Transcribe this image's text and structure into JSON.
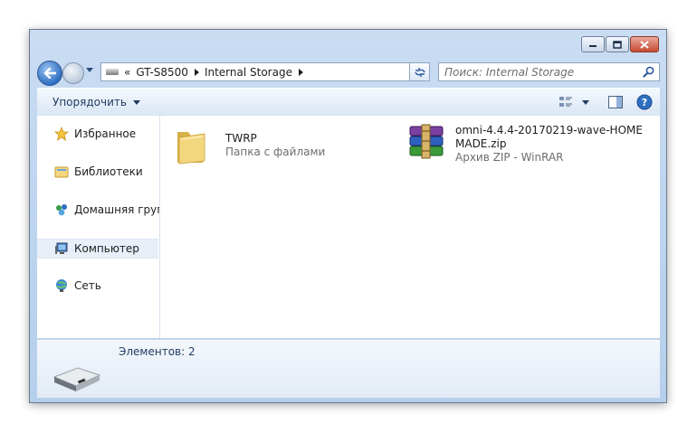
{
  "window": {
    "controls": {
      "minimize_icon": "minimize-icon",
      "maximize_icon": "maximize-icon",
      "close_icon": "close-icon"
    }
  },
  "address": {
    "overflow": "«",
    "segments": [
      "GT-S8500",
      "Internal Storage"
    ]
  },
  "search": {
    "placeholder": "Поиск: Internal Storage"
  },
  "toolbar": {
    "organize_label": "Упорядочить",
    "view_icon": "view-options-icon",
    "preview_icon": "preview-pane-icon",
    "help_icon": "help-icon"
  },
  "sidebar": {
    "items": [
      {
        "label": "Избранное",
        "icon": "star-icon"
      },
      {
        "label": "Библиотеки",
        "icon": "libraries-icon"
      },
      {
        "label": "Домашняя группа",
        "icon": "homegroup-icon"
      },
      {
        "label": "Компьютер",
        "icon": "computer-icon",
        "selected": true
      },
      {
        "label": "Сеть",
        "icon": "network-icon"
      }
    ]
  },
  "files": [
    {
      "name": "TWRP",
      "type": "Папка с файлами",
      "icon": "folder-icon"
    },
    {
      "name_line1": "omni-4.4.4-20170219-wave-HOME",
      "name_line2": "MADE.zip",
      "type": "Архив ZIP - WinRAR",
      "icon": "winrar-archive-icon"
    }
  ],
  "details": {
    "count_text": "Элементов: 2",
    "icon": "device-icon"
  },
  "colors": {
    "frame": "#bcd3ee",
    "close_button": "#c74a33",
    "back_button": "#2f6fc1"
  }
}
